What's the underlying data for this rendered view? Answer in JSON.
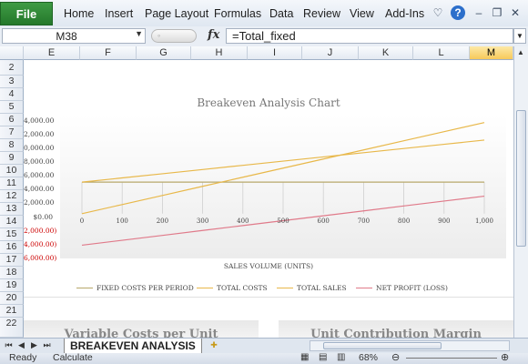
{
  "ribbon": {
    "file": "File",
    "tabs": [
      "Home",
      "Insert",
      "Page Layout",
      "Formulas",
      "Data",
      "Review",
      "View",
      "Add-Ins"
    ]
  },
  "formula_bar": {
    "name_box": "M38",
    "fx": "fx",
    "formula": "=Total_fixed"
  },
  "columns": [
    "E",
    "F",
    "G",
    "H",
    "I",
    "J",
    "K",
    "L",
    "M"
  ],
  "selected_column": "M",
  "rows": [
    "2",
    "3",
    "4",
    "5",
    "6",
    "7",
    "8",
    "9",
    "10",
    "11",
    "12",
    "13",
    "14",
    "15",
    "16",
    "17",
    "18",
    "19",
    "20",
    "21",
    "22"
  ],
  "chart": {
    "title": "Breakeven Analysis  Chart",
    "y_ticks": [
      "4,000.00",
      "2,000.00",
      "0,000.00",
      "8,000.00",
      "6,000.00",
      "4,000.00",
      "2,000.00",
      "$0.00",
      "2,000.00)",
      "4,000.00)",
      "6,000.00)"
    ],
    "x_ticks": [
      "0",
      "100",
      "200",
      "300",
      "400",
      "500",
      "600",
      "700",
      "800",
      "900",
      "1,000"
    ],
    "x_title": "SALES VOLUME (UNITS)",
    "legend": [
      "FIXED COSTS PER PERIOD",
      "TOTAL COSTS",
      "TOTAL SALES",
      "NET PROFIT (LOSS)"
    ]
  },
  "chart_data": {
    "type": "line",
    "title": "Breakeven Analysis  Chart",
    "xlabel": "SALES VOLUME (UNITS)",
    "ylabel": "",
    "x": [
      0,
      100,
      200,
      300,
      400,
      500,
      600,
      700,
      800,
      900,
      1000
    ],
    "ylim": [
      -6000,
      14000
    ],
    "series": [
      {
        "name": "FIXED COSTS PER PERIOD",
        "color": "#b7a86a",
        "values": [
          4500,
          4500,
          4500,
          4500,
          4500,
          4500,
          4500,
          4500,
          4500,
          4500,
          4500
        ]
      },
      {
        "name": "TOTAL COSTS",
        "color": "#e8b84a",
        "values": [
          4500,
          5100,
          5700,
          6300,
          6900,
          7500,
          8100,
          8700,
          9300,
          9900,
          10500
        ]
      },
      {
        "name": "TOTAL SALES",
        "color": "#e8b84a",
        "values": [
          0,
          1300,
          2600,
          3900,
          5200,
          6500,
          7800,
          9100,
          10400,
          11700,
          13000
        ]
      },
      {
        "name": "NET PROFIT (LOSS)",
        "color": "#e07a8a",
        "values": [
          -4500,
          -3800,
          -3100,
          -2400,
          -1700,
          -1000,
          -300,
          400,
          1100,
          1800,
          2500
        ]
      }
    ]
  },
  "panels": [
    "Variable Costs per Unit",
    "Unit Contribution Margin"
  ],
  "sheet_tab": "BREAKEVEN ANALYSIS",
  "status": {
    "ready": "Ready",
    "calculate": "Calculate",
    "zoom": "68%"
  }
}
